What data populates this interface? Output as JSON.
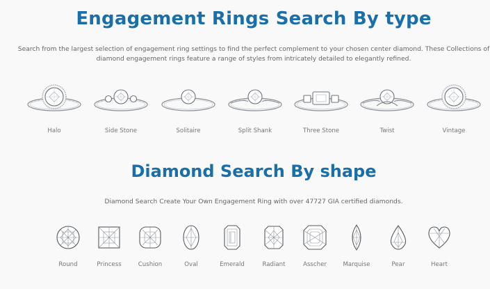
{
  "rings_section": {
    "title": "Engagement Rings Search By type",
    "description_line1": "Search from the largest selection of engagement ring settings to find the perfect complement to your chosen center diamond. These Collections of",
    "description_line2": "diamond engagement rings feature a range of styles from intricately detailed to elegantly refined.",
    "types": [
      {
        "label": "Halo",
        "icon": "halo-ring-icon"
      },
      {
        "label": "Side Stone",
        "icon": "side-stone-ring-icon"
      },
      {
        "label": "Solitaire",
        "icon": "solitaire-ring-icon"
      },
      {
        "label": "Split Shank",
        "icon": "split-shank-ring-icon"
      },
      {
        "label": "Three Stone",
        "icon": "three-stone-ring-icon"
      },
      {
        "label": "Twist",
        "icon": "twist-ring-icon"
      },
      {
        "label": "Vintage",
        "icon": "vintage-ring-icon"
      }
    ]
  },
  "diamond_section": {
    "title": "Diamond Search By shape",
    "subtitle": "Diamond Search Create Your Own Engagement Ring with over 47727 GIA certified diamonds.",
    "shapes": [
      {
        "label": "Round",
        "icon": "round-diamond-icon"
      },
      {
        "label": "Princess",
        "icon": "princess-diamond-icon"
      },
      {
        "label": "Cushion",
        "icon": "cushion-diamond-icon"
      },
      {
        "label": "Oval",
        "icon": "oval-diamond-icon"
      },
      {
        "label": "Emerald",
        "icon": "emerald-diamond-icon"
      },
      {
        "label": "Radiant",
        "icon": "radiant-diamond-icon"
      },
      {
        "label": "Asscher",
        "icon": "asscher-diamond-icon"
      },
      {
        "label": "Marquise",
        "icon": "marquise-diamond-icon"
      },
      {
        "label": "Pear",
        "icon": "pear-diamond-icon"
      },
      {
        "label": "Heart",
        "icon": "heart-diamond-icon"
      }
    ]
  },
  "colors": {
    "heading": "#1a6fa8",
    "text": "#666666",
    "background": "#f9f9f9"
  }
}
